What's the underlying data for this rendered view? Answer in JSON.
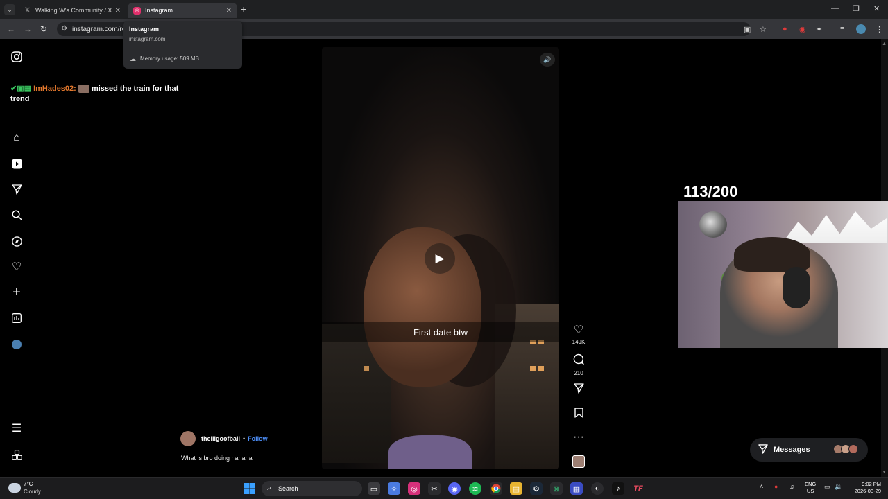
{
  "browser": {
    "tabs": [
      {
        "title": "Walking W's Community / X",
        "icon": "x-logo-icon"
      },
      {
        "title": "Instagram",
        "icon": "instagram-icon",
        "active": true
      }
    ],
    "url": "instagram.com/re",
    "hover_card": {
      "title": "Instagram",
      "domain": "instagram.com",
      "memory": "Memory usage: 509 MB"
    }
  },
  "chat_overlay": {
    "username": "ImHades02:",
    "message": "missed the train for that trend"
  },
  "reel": {
    "caption_overlay": "First date btw",
    "author": "thelilgoofball",
    "separator": "•",
    "follow_label": "Follow",
    "caption": "What is bro doing hahaha",
    "likes": "149K",
    "comments": "210"
  },
  "stream": {
    "counter": "113/200"
  },
  "messages": {
    "label": "Messages"
  },
  "taskbar": {
    "temperature": "7°C",
    "condition": "Cloudy",
    "search_label": "Search",
    "lang_line1": "ENG",
    "lang_line2": "US",
    "time": "9:02 PM",
    "date": "2026-03-29"
  },
  "colors": {
    "follow": "#4c8df6",
    "chat_username": "#e3782d",
    "chat_badges": "#39c35e"
  }
}
